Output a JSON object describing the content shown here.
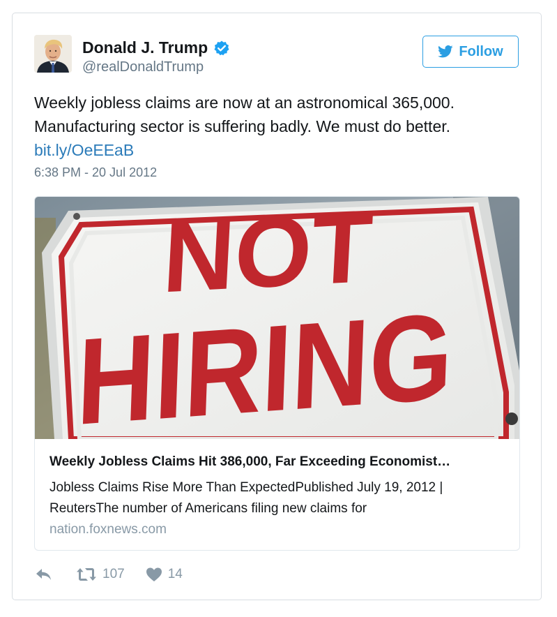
{
  "author": {
    "name": "Donald J. Trump",
    "handle": "@realDonaldTrump",
    "verified": true,
    "avatar_icon": "profile-photo"
  },
  "follow_button": {
    "label": "Follow",
    "icon": "twitter-bird-icon",
    "color": "#2b9ee2"
  },
  "tweet": {
    "text_lines": [
      "Weekly jobless claims are now at an astronomical 365,000.",
      "Manufacturing sector is suffering badly. We must do better."
    ],
    "link": "bit.ly/OeEEaB",
    "timestamp": "6:38 PM - 20 Jul 2012"
  },
  "card": {
    "image_sign_text": [
      "NOT",
      "HIRING"
    ],
    "title": "Weekly Jobless Claims Hit 386,000, Far Exceeding Economist…",
    "description_lines": [
      "Jobless Claims Rise More Than ExpectedPublished July 19, 2012 |",
      "ReutersThe number of Americans filing new claims for"
    ],
    "domain": "nation.foxnews.com"
  },
  "actions": {
    "reply_icon": "reply-icon",
    "retweet_icon": "retweet-icon",
    "retweet_count": "107",
    "like_icon": "heart-icon",
    "like_count": "14"
  },
  "colors": {
    "link": "#2b7bb9",
    "muted": "#657786",
    "sign_red": "#c0272d",
    "verified_blue": "#1da1f2"
  }
}
